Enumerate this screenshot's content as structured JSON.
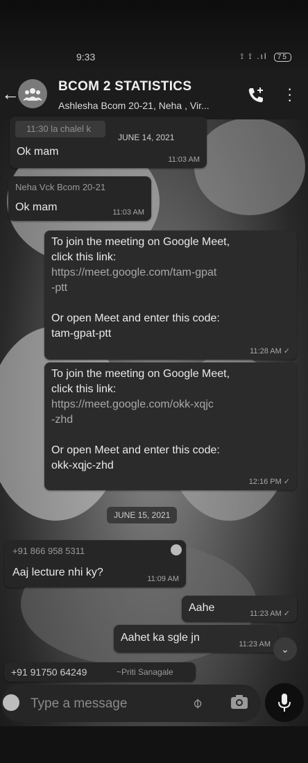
{
  "status_bar": {
    "time": "9:33",
    "signal": "⟟ ⟟ .ıl",
    "battery": "75"
  },
  "header": {
    "back": "←",
    "title": "BCOM 2 STATISTICS",
    "subtitle": "Ashlesha Bcom 20-21, Neha , Vir..."
  },
  "messages": {
    "m1": {
      "quote": "11:30 la chalel k",
      "text": "Ok mam",
      "time": "11:03 AM"
    },
    "m2": {
      "sender": "Neha Vck Bcom 20-21",
      "text": "Ok mam",
      "time": "11:03 AM"
    },
    "m3": {
      "line1": "To join the meeting on Google Meet,",
      "line2": "click this link:",
      "link1": "https://meet.google.com/tam-gpat",
      "link2": "-ptt",
      "line3": "Or open Meet and enter this code:",
      "code": "tam-gpat-ptt",
      "time": "11:28 AM",
      "tick": "✓"
    },
    "m4": {
      "line1": "To join the meeting on Google Meet,",
      "line2": "click this link:",
      "link1": "https://meet.google.com/okk-xqjc",
      "link2": "-zhd",
      "line3": "Or open Meet and enter this code:",
      "code": "okk-xqjc-zhd",
      "time": "12:16 PM",
      "tick": "✓"
    },
    "m5": {
      "sender": "+91 866 958 5311",
      "text": "Aaj lecture nhi ky?",
      "time": "11:09 AM"
    },
    "m6": {
      "text": "Aahe",
      "time": "11:23 AM",
      "tick": "✓"
    },
    "m7": {
      "text": "Aahet ka sgle jn",
      "time": "11:23 AM"
    },
    "m8": {
      "sender": "+91 91750 64249",
      "sender_name": "~Priti Sanagale"
    }
  },
  "dates": {
    "d1": "JUNE 14, 2021",
    "d2": "JUNE 15, 2021"
  },
  "input": {
    "placeholder": "Type a message"
  },
  "icons": [
    "back-arrow-icon",
    "group-avatar-icon",
    "add-call-icon",
    "more-icon",
    "emoji-icon",
    "attach-icon",
    "camera-icon",
    "mic-icon",
    "chevron-down-icon"
  ]
}
